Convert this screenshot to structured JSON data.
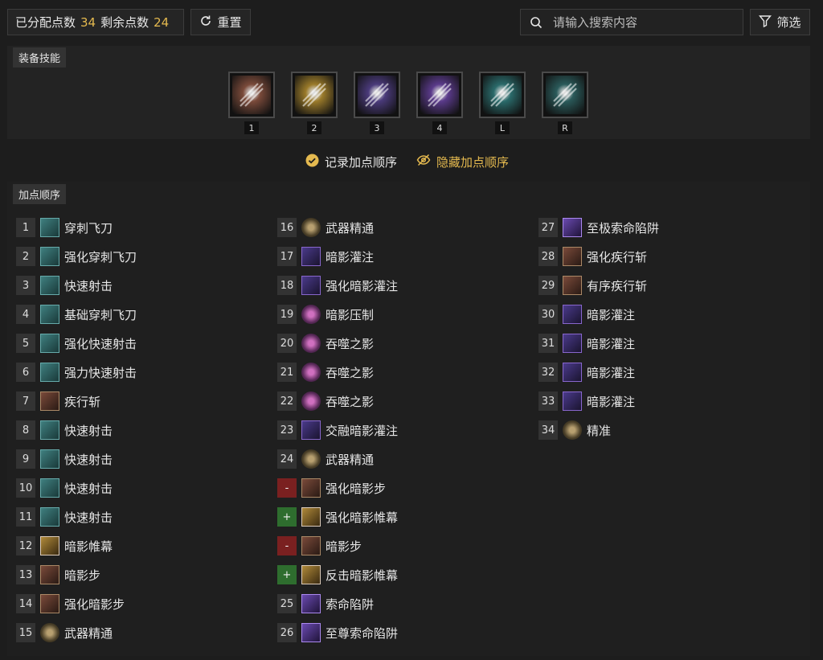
{
  "header": {
    "allocated_label": "已分配点数",
    "allocated_value": "34",
    "remaining_label": "剩余点数",
    "remaining_value": "24",
    "reset_label": "重置",
    "search_placeholder": "请输入搜索内容",
    "filter_label": "筛选"
  },
  "equipped": {
    "title": "装备技能",
    "slots": [
      {
        "key": "1",
        "icon": "penetrating-shot-icon",
        "color": "#7a4a3a"
      },
      {
        "key": "2",
        "icon": "dark-shroud-icon",
        "color": "#9a7a2a"
      },
      {
        "key": "3",
        "icon": "shadow-imbuement-icon",
        "color": "#4a3a7a"
      },
      {
        "key": "4",
        "icon": "shadow-trap-icon",
        "color": "#5a3a8a"
      },
      {
        "key": "L",
        "icon": "skull-blade-icon",
        "color": "#2a6a6a"
      },
      {
        "key": "R",
        "icon": "rapid-fire-icon",
        "color": "#2a5a5a"
      }
    ]
  },
  "options": {
    "record_label": "记录加点顺序",
    "hide_label": "隐藏加点顺序"
  },
  "order": {
    "title": "加点顺序",
    "columns": [
      [
        {
          "badge": "1",
          "name": "穿刺飞刀",
          "icon": "teal"
        },
        {
          "badge": "2",
          "name": "强化穿刺飞刀",
          "icon": "teal"
        },
        {
          "badge": "3",
          "name": "快速射击",
          "icon": "teal"
        },
        {
          "badge": "4",
          "name": "基础穿刺飞刀",
          "icon": "teal"
        },
        {
          "badge": "5",
          "name": "强化快速射击",
          "icon": "teal"
        },
        {
          "badge": "6",
          "name": "强力快速射击",
          "icon": "teal"
        },
        {
          "badge": "7",
          "name": "疾行斩",
          "icon": "rust"
        },
        {
          "badge": "8",
          "name": "快速射击",
          "icon": "teal"
        },
        {
          "badge": "9",
          "name": "快速射击",
          "icon": "teal"
        },
        {
          "badge": "10",
          "name": "快速射击",
          "icon": "teal"
        },
        {
          "badge": "11",
          "name": "快速射击",
          "icon": "teal"
        },
        {
          "badge": "12",
          "name": "暗影帷幕",
          "icon": "gold"
        },
        {
          "badge": "13",
          "name": "暗影步",
          "icon": "rust"
        },
        {
          "badge": "14",
          "name": "强化暗影步",
          "icon": "rust"
        },
        {
          "badge": "15",
          "name": "武器精通",
          "icon": "round"
        }
      ],
      [
        {
          "badge": "16",
          "name": "武器精通",
          "icon": "round"
        },
        {
          "badge": "17",
          "name": "暗影灌注",
          "icon": "purple"
        },
        {
          "badge": "18",
          "name": "强化暗影灌注",
          "icon": "purple"
        },
        {
          "badge": "19",
          "name": "暗影压制",
          "icon": "roundpurple"
        },
        {
          "badge": "20",
          "name": "吞噬之影",
          "icon": "roundpurple"
        },
        {
          "badge": "21",
          "name": "吞噬之影",
          "icon": "roundpurple"
        },
        {
          "badge": "22",
          "name": "吞噬之影",
          "icon": "roundpurple"
        },
        {
          "badge": "23",
          "name": "交融暗影灌注",
          "icon": "purple"
        },
        {
          "badge": "24",
          "name": "武器精通",
          "icon": "round"
        },
        {
          "badge": "-",
          "name": "强化暗影步",
          "icon": "rust",
          "type": "minus"
        },
        {
          "badge": "+",
          "name": "强化暗影帷幕",
          "icon": "gold",
          "type": "plus"
        },
        {
          "badge": "-",
          "name": "暗影步",
          "icon": "rust",
          "type": "minus"
        },
        {
          "badge": "+",
          "name": "反击暗影帷幕",
          "icon": "gold",
          "type": "plus"
        },
        {
          "badge": "25",
          "name": "索命陷阱",
          "icon": "violet"
        },
        {
          "badge": "26",
          "name": "至尊索命陷阱",
          "icon": "violet"
        }
      ],
      [
        {
          "badge": "27",
          "name": "至极索命陷阱",
          "icon": "violet"
        },
        {
          "badge": "28",
          "name": "强化疾行斩",
          "icon": "rust"
        },
        {
          "badge": "29",
          "name": "有序疾行斩",
          "icon": "rust"
        },
        {
          "badge": "30",
          "name": "暗影灌注",
          "icon": "purple"
        },
        {
          "badge": "31",
          "name": "暗影灌注",
          "icon": "purple"
        },
        {
          "badge": "32",
          "name": "暗影灌注",
          "icon": "purple"
        },
        {
          "badge": "33",
          "name": "暗影灌注",
          "icon": "purple"
        },
        {
          "badge": "34",
          "name": "精准",
          "icon": "round"
        }
      ]
    ]
  }
}
